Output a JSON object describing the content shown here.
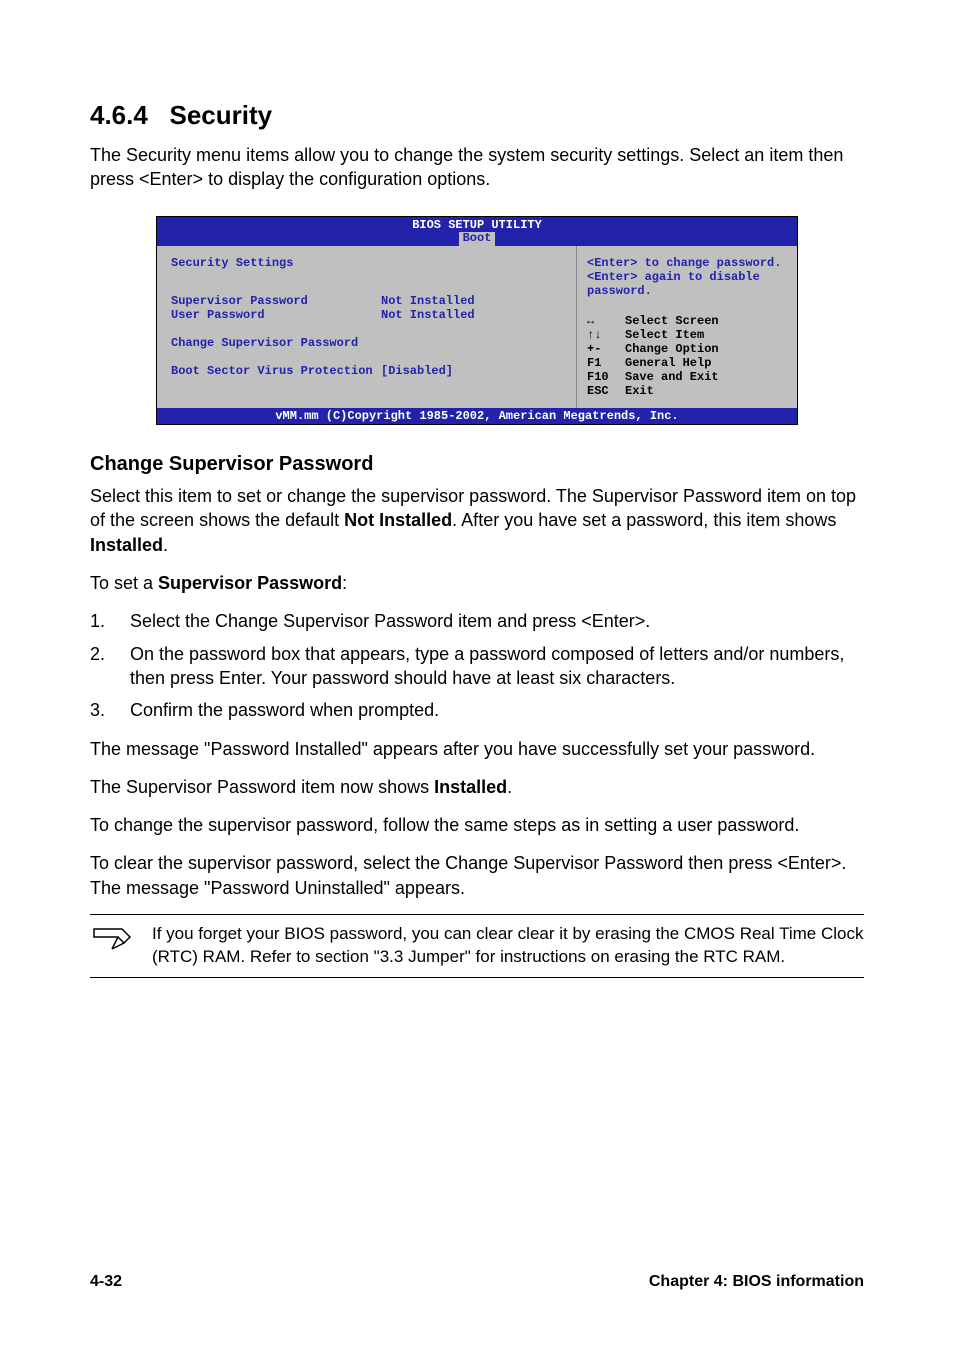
{
  "heading": {
    "number": "4.6.4",
    "title": "Security"
  },
  "intro": "The Security menu items allow you to change the system security settings. Select an item then press <Enter> to display the configuration options.",
  "bios": {
    "title": "BIOS SETUP UTILITY",
    "tab": "Boot",
    "section_heading": "Security Settings",
    "rows": {
      "supervisor_label": "Supervisor Password",
      "supervisor_value": "Not Installed",
      "user_label": "User Password",
      "user_value": "Not Installed",
      "change_supervisor": "Change Supervisor Password",
      "boot_sector_label": "Boot Sector Virus Protection",
      "boot_sector_value": "[Disabled]"
    },
    "help": {
      "line1": "<Enter> to change password.",
      "line2": "<Enter> again to disable password."
    },
    "keys": [
      {
        "k": "↔",
        "d": "Select Screen"
      },
      {
        "k": "↑↓",
        "d": "Select Item"
      },
      {
        "k": "+-",
        "d": "Change Option"
      },
      {
        "k": "F1",
        "d": "General Help"
      },
      {
        "k": "F10",
        "d": "Save and Exit"
      },
      {
        "k": "ESC",
        "d": "Exit"
      }
    ],
    "footer": "vMM.mm (C)Copyright 1985-2002, American Megatrends, Inc."
  },
  "subhead": "Change Supervisor Password",
  "p1_a": "Select this item to set or change the supervisor password. The Supervisor Password item on top of the screen shows the default ",
  "p1_b": "Not Installed",
  "p1_c": ". After you have set a password, this item shows ",
  "p1_d": "Installed",
  "p1_e": ".",
  "toset_a": "To set a ",
  "toset_b": "Supervisor Password",
  "toset_c": ":",
  "steps": [
    "Select the Change Supervisor Password item and press <Enter>.",
    "On the password box that appears, type a password composed of letters and/or numbers, then press Enter. Your password should have at least six characters.",
    "Confirm the password when prompted."
  ],
  "p2": "The message \"Password Installed\" appears after you have successfully set your password.",
  "p3_a": "The Supervisor Password item now shows ",
  "p3_b": "Installed",
  "p3_c": ".",
  "p4": "To change the supervisor password, follow the same steps as in setting a user password.",
  "p5": "To clear the supervisor password, select the Change Supervisor Password then press <Enter>. The message \"Password Uninstalled\" appears.",
  "note": "If you forget your BIOS password, you can clear clear it by erasing the CMOS Real Time Clock (RTC) RAM. Refer to section \"3.3 Jumper\" for instructions on erasing the RTC RAM.",
  "footer": {
    "left": "4-32",
    "right": "Chapter 4: BIOS information"
  }
}
